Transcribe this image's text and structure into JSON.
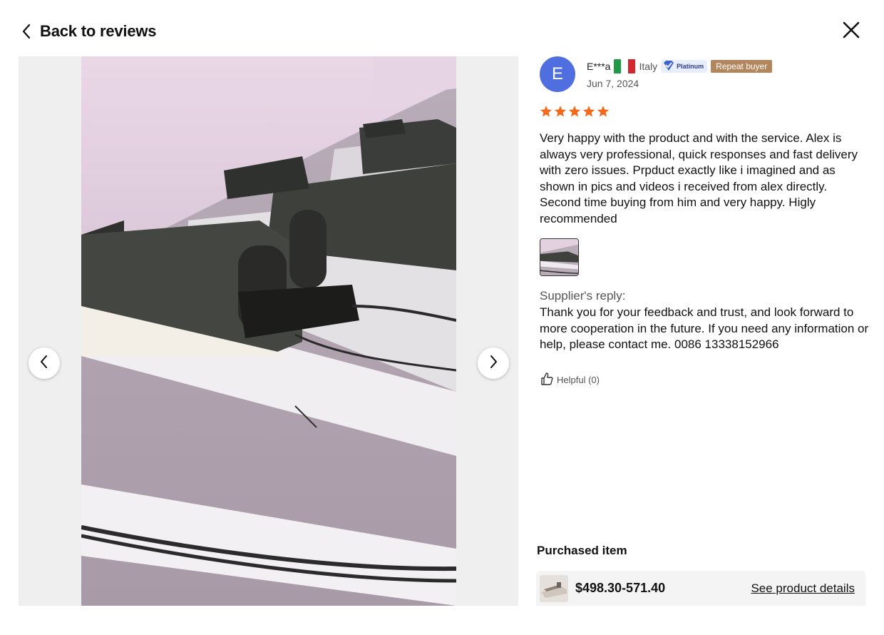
{
  "header": {
    "back_label": "Back to reviews",
    "back_icon": "chevron-left-icon",
    "close_icon": "close-icon"
  },
  "gallery": {
    "prev_icon": "chevron-left-icon",
    "next_icon": "chevron-right-icon"
  },
  "review": {
    "avatar_initial": "E",
    "avatar_color": "#4f6fe0",
    "reviewer_name": "E***a",
    "country": "Italy",
    "flag": [
      "#1f9a47",
      "#ffffff",
      "#d3262f"
    ],
    "platinum_label": "Platinum",
    "repeat_label": "Repeat buyer",
    "repeat_color": "#b3875e",
    "date": "Jun 7, 2024",
    "rating": 5,
    "star_color": "#f26a1b",
    "text": "Very happy with the product and with the service. Alex is always very professional, quick responses and fast delivery with zero issues. Prpduct exactly like i imagined and as shown in pics and videos i received from alex directly. Second time buying from him and very happy. Higly recommended",
    "supplier_reply_label": "Supplier's reply:",
    "supplier_reply": "Thank you for your feedback and trust, and look forward to more cooperation in the future. If you need any information or help, please contact me. 0086 13338152966",
    "helpful_label": "Helpful (0)",
    "helpful_icon": "thumbs-up-icon"
  },
  "purchased": {
    "title": "Purchased item",
    "price": "$498.30-571.40",
    "details_link": "See product details"
  }
}
